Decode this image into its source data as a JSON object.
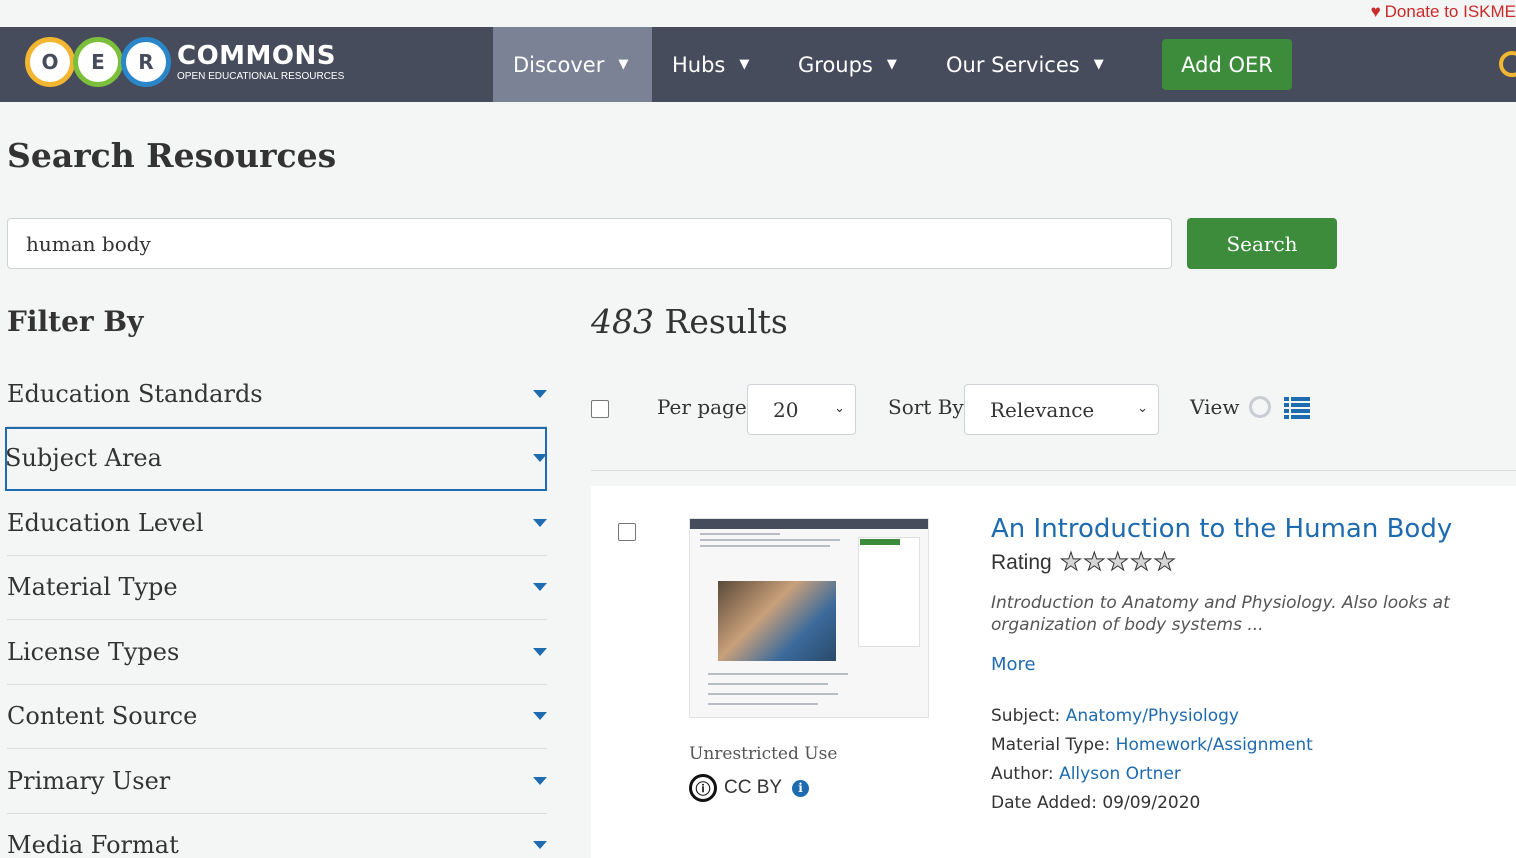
{
  "donate": {
    "label": "Donate to ISKME"
  },
  "logo": {
    "letters": [
      "O",
      "E",
      "R"
    ],
    "title": "COMMONS",
    "subtitle": "OPEN EDUCATIONAL RESOURCES"
  },
  "nav": {
    "items": [
      {
        "label": "Discover",
        "active": true
      },
      {
        "label": "Hubs"
      },
      {
        "label": "Groups"
      },
      {
        "label": "Our Services"
      }
    ],
    "add_oer": "Add OER"
  },
  "search": {
    "page_title": "Search Resources",
    "query": "human body",
    "button": "Search"
  },
  "filters": {
    "heading": "Filter By",
    "items": [
      {
        "label": "Education Standards"
      },
      {
        "label": "Subject Area",
        "focused": true
      },
      {
        "label": "Education Level"
      },
      {
        "label": "Material Type"
      },
      {
        "label": "License Types"
      },
      {
        "label": "Content Source"
      },
      {
        "label": "Primary User"
      },
      {
        "label": "Media Format"
      }
    ]
  },
  "results": {
    "count": "483",
    "count_label": "Results",
    "per_page_label": "Per page",
    "per_page_value": "20",
    "sort_label": "Sort By",
    "sort_value": "Relevance",
    "view_label": "View"
  },
  "result": {
    "title": "An Introduction to the Human Body",
    "rating_label": "Rating",
    "rating_stars": 0,
    "rating_max": 5,
    "description": "Introduction to Anatomy and Physiology.  Also looks at organization of body systems ...",
    "more": "More",
    "usage": "Unrestricted Use",
    "license": "CC BY",
    "subject_label": "Subject:",
    "subject": "Anatomy/Physiology",
    "material_label": "Material Type:",
    "material": "Homework/Assignment",
    "author_label": "Author:",
    "author": "Allyson Ortner",
    "date_label": "Date Added:",
    "date": "09/09/2020"
  },
  "colors": {
    "nav_bg": "#464c5c",
    "nav_active": "#7c8295",
    "green": "#3c8c3c",
    "link": "#1f6bb0",
    "donate": "#c92a2a"
  }
}
